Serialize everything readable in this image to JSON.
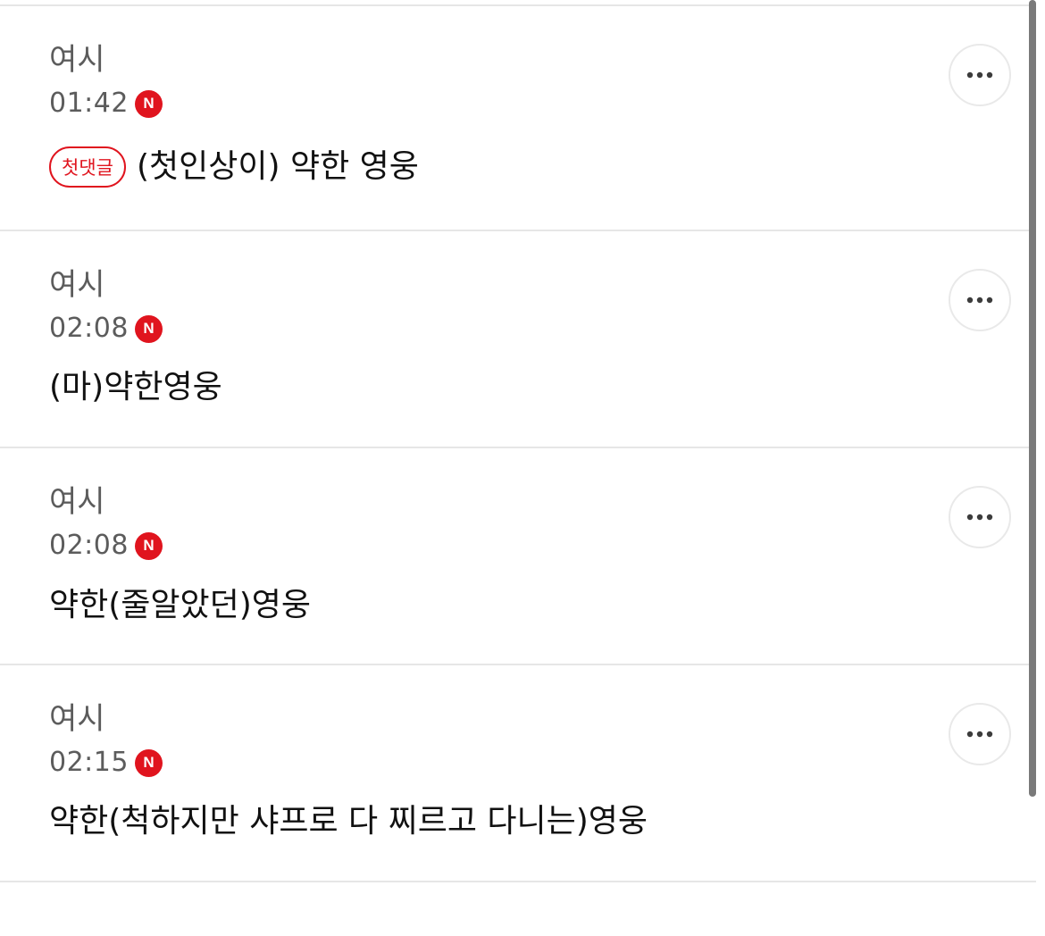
{
  "comments": [
    {
      "author": "여시",
      "time": "01:42",
      "new_badge": "N",
      "first_comment_badge": "첫댓글",
      "text": "(첫인상이) 약한 영웅",
      "more_icon": "more-horizontal-icon"
    },
    {
      "author": "여시",
      "time": "02:08",
      "new_badge": "N",
      "text": "(마)약한영웅",
      "more_icon": "more-horizontal-icon"
    },
    {
      "author": "여시",
      "time": "02:08",
      "new_badge": "N",
      "text": "약한(줄알았던)영웅",
      "more_icon": "more-horizontal-icon"
    },
    {
      "author": "여시",
      "time": "02:15",
      "new_badge": "N",
      "text": "약한(척하지만 샤프로 다 찌르고 다니는)영웅",
      "more_icon": "more-horizontal-icon"
    }
  ],
  "colors": {
    "accent_red": "#e0141e",
    "meta_gray": "#5c5c5c",
    "text_black": "#111111",
    "divider": "#e6e6e6"
  }
}
